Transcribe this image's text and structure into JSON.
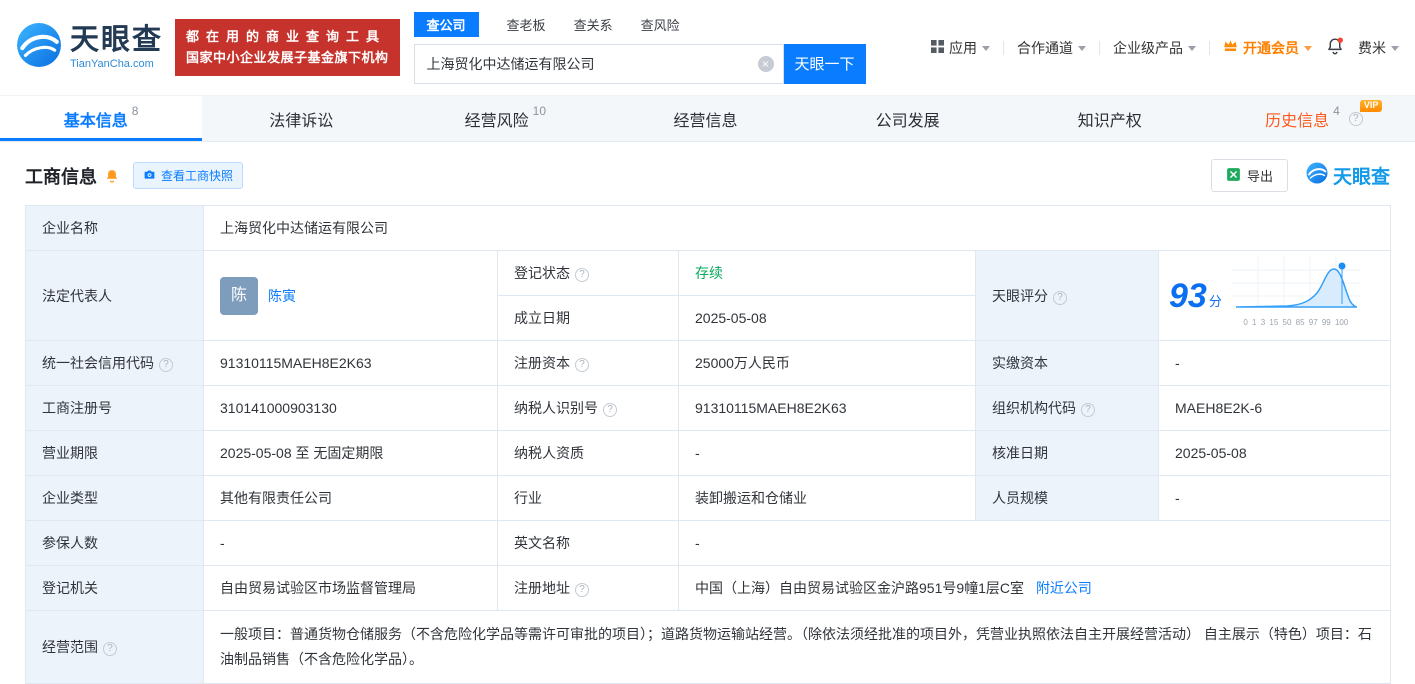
{
  "header": {
    "logo": {
      "brand": "天眼查",
      "domain": "TianYanCha.com"
    },
    "banner": {
      "line1": "都在用的商业查询工具",
      "line2": "国家中小企业发展子基金旗下机构"
    },
    "search": {
      "tab_company": "查公司",
      "tab_boss": "查老板",
      "tab_relation": "查关系",
      "tab_risk": "查风险",
      "value": "上海贸化中达储运有限公司",
      "submit": "天眼一下"
    },
    "nav": {
      "apps": "应用",
      "partners": "合作通道",
      "enterprise": "企业级产品",
      "vip": "开通会员",
      "user": "费米"
    }
  },
  "tabs": [
    {
      "label": "基本信息",
      "count": "8"
    },
    {
      "label": "法律诉讼",
      "count": ""
    },
    {
      "label": "经营风险",
      "count": "10"
    },
    {
      "label": "经营信息",
      "count": ""
    },
    {
      "label": "公司发展",
      "count": ""
    },
    {
      "label": "知识产权",
      "count": ""
    },
    {
      "label": "历史信息",
      "count": "4",
      "badge": "VIP"
    }
  ],
  "section": {
    "title": "工商信息",
    "snapshot": "查看工商快照",
    "export": "导出",
    "watermark": "天眼查"
  },
  "info": {
    "company_name": {
      "label": "企业名称",
      "value": "上海贸化中达储运有限公司"
    },
    "legal_rep": {
      "label": "法定代表人",
      "avatar": "陈",
      "name": "陈寅"
    },
    "reg_status": {
      "label": "登记状态",
      "value": "存续"
    },
    "establish_date": {
      "label": "成立日期",
      "value": "2025-05-08"
    },
    "score": {
      "label": "天眼评分",
      "value": "93",
      "unit": "分",
      "axis": "0 1 3 15 50 85 97 99 100"
    },
    "credit_code": {
      "label": "统一社会信用代码",
      "value": "91310115MAEH8E2K63"
    },
    "reg_capital": {
      "label": "注册资本",
      "value": "25000万人民币"
    },
    "paid_capital": {
      "label": "实缴资本",
      "value": "-"
    },
    "reg_number": {
      "label": "工商注册号",
      "value": "310141000903130"
    },
    "taxpayer_id": {
      "label": "纳税人识别号",
      "value": "91310115MAEH8E2K63"
    },
    "org_code": {
      "label": "组织机构代码",
      "value": "MAEH8E2K-6"
    },
    "business_term": {
      "label": "营业期限",
      "value": "2025-05-08 至 无固定期限"
    },
    "taxpayer_quality": {
      "label": "纳税人资质",
      "value": "-"
    },
    "approve_date": {
      "label": "核准日期",
      "value": "2025-05-08"
    },
    "company_type": {
      "label": "企业类型",
      "value": "其他有限责任公司"
    },
    "industry": {
      "label": "行业",
      "value": "装卸搬运和仓储业"
    },
    "staff_size": {
      "label": "人员规模",
      "value": "-"
    },
    "insured_count": {
      "label": "参保人数",
      "value": "-"
    },
    "english_name": {
      "label": "英文名称",
      "value": "-"
    },
    "reg_authority": {
      "label": "登记机关",
      "value": "自由贸易试验区市场监督管理局"
    },
    "reg_address": {
      "label": "注册地址",
      "value": "中国（上海）自由贸易试验区金沪路951号9幢1层C室",
      "nearby": "附近公司"
    },
    "business_scope": {
      "label": "经营范围",
      "value": "一般项目：普通货物仓储服务（不含危险化学品等需许可审批的项目）；道路货物运输站经营。（除依法须经批准的项目外，凭营业执照依法自主开展经营活动） 自主展示（特色）项目：石油制品销售（不含危险化学品）。"
    }
  },
  "colors": {
    "primary": "#0a7cff",
    "banner_red": "#c5332c",
    "status_green": "#0aa95e",
    "history_orange": "#ff5a1e",
    "label_bg": "#ecf3fb"
  }
}
